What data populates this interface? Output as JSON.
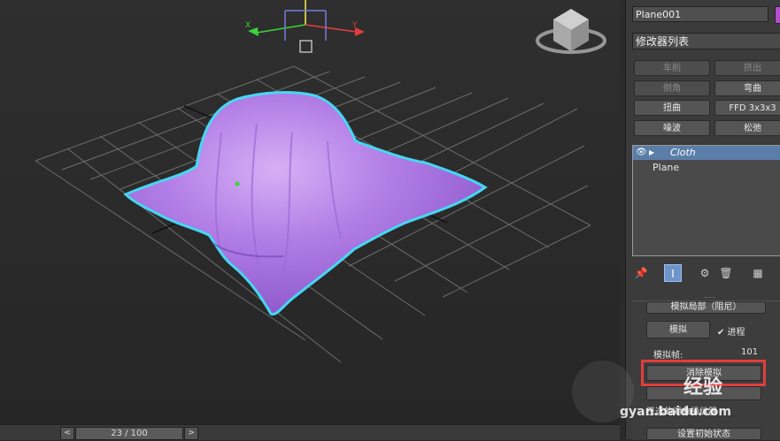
{
  "viewport": {
    "gizmo": {
      "x_label": "X",
      "y_label": "Y"
    },
    "surface_color": "#b27ee6",
    "outline_color": "#45d7f2"
  },
  "timeline": {
    "prev": "<",
    "next": ">",
    "frame": "23 / 100"
  },
  "panel": {
    "object_name": "Plane001",
    "modifier_list": "修改器列表",
    "buttons": [
      {
        "label": "车削",
        "enabled": false
      },
      {
        "label": "挤出",
        "enabled": false
      },
      {
        "label": "倒角",
        "enabled": false
      },
      {
        "label": "弯曲",
        "enabled": true
      },
      {
        "label": "扭曲",
        "enabled": true
      },
      {
        "label": "FFD 3x3x3",
        "enabled": true
      },
      {
        "label": "噪波",
        "enabled": true
      },
      {
        "label": "松弛",
        "enabled": true
      }
    ],
    "stack": [
      {
        "label": "Cloth",
        "selected": true
      },
      {
        "label": "Plane",
        "selected": false
      }
    ],
    "tools": [
      "pin-icon",
      "show-end-result-icon",
      "make-unique-icon",
      "remove-modifier-icon",
      "configure-icon"
    ],
    "rollout": {
      "top_button": "模拟局部（阻尼）",
      "simulate": "模拟",
      "progress_check": "✔ 进程",
      "frames_label": "模拟帧:",
      "frames_value": "101",
      "erase_sim": "消除模拟",
      "bottom_label": "已选的对象操纵器",
      "bottom_button": "设置初始状态"
    }
  },
  "watermark": {
    "brand": "经验",
    "url": "gyan.baidu.com"
  }
}
